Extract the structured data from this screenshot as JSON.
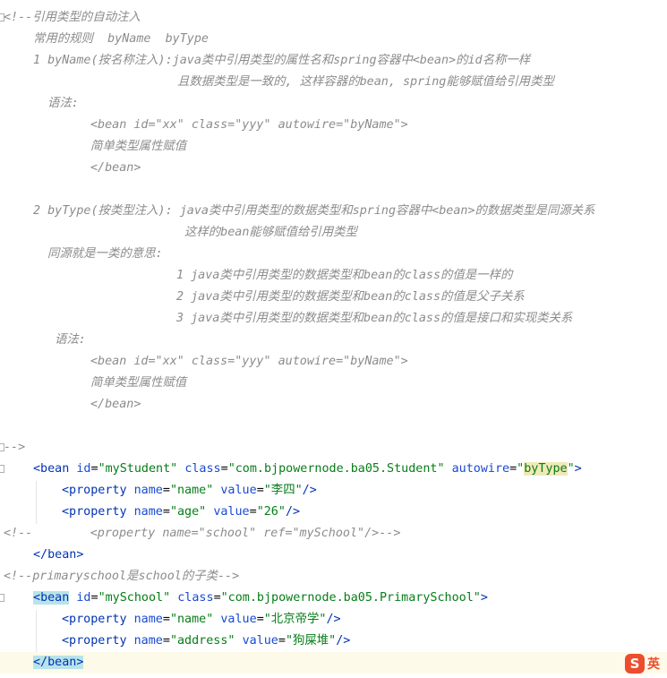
{
  "editor": {
    "lines": [
      "<!--引用类型的自动注入",
      "常用的规则  byName  byType",
      "1 byName(按名称注入):java类中引用类型的属性名和spring容器中<bean>的id名称一样",
      "且数据类型是一致的, 这样容器的bean, spring能够赋值给引用类型",
      "语法:",
      "<bean id=\"xx\" class=\"yyy\" autowire=\"byName\">",
      "简单类型属性赋值",
      "</bean>",
      "2 byType(按类型注入): java类中引用类型的数据类型和spring容器中<bean>的数据类型是同源关系",
      "这样的bean能够赋值给引用类型",
      "同源就是一类的意思:",
      "1 java类中引用类型的数据类型和bean的class的值是一样的",
      "2 java类中引用类型的数据类型和bean的class的值是父子关系",
      "3 java类中引用类型的数据类型和bean的class的值是接口和实现类关系",
      "语法:",
      "<bean id=\"xx\" class=\"yyy\" autowire=\"byName\">",
      "简单类型属性赋值",
      "</bean>",
      "-->"
    ],
    "code": {
      "bean1": {
        "open": "<bean",
        "id_attr": "id",
        "id_val": "\"myStudent\"",
        "class_attr": "class",
        "class_val": "\"com.bjpowernode.ba05.Student\"",
        "autowire_attr": "autowire",
        "q1": "\"",
        "autowire_val": "byType",
        "q2": "\"",
        "close": ">"
      },
      "prop_name": {
        "open": "<property",
        "attr1": "name",
        "val1": "\"name\"",
        "attr2": "value",
        "val2": "\"李四\"",
        "close": "/>"
      },
      "prop_age": {
        "open": "<property",
        "attr1": "name",
        "val1": "\"age\"",
        "attr2": "value",
        "val2": "\"26\"",
        "close": "/>"
      },
      "commented_prop": "<!--        <property name=\"school\" ref=\"mySchool\"/>-->",
      "bean1_end": "</bean>",
      "comment_primary": "<!--primaryschool是school的子类-->",
      "bean2": {
        "open_lt": "<",
        "open_word": "bean",
        "id_attr": "id",
        "id_val": "\"mySchool\"",
        "class_attr": "class",
        "class_val": "\"com.bjpowernode.ba05.PrimarySchool\"",
        "close": ">"
      },
      "prop_school_name": {
        "open": "<property",
        "attr1": "name",
        "val1": "\"name\"",
        "attr2": "value",
        "val2": "\"北京帝学\"",
        "close": "/>"
      },
      "prop_address": {
        "open": "<property",
        "attr1": "name",
        "val1": "\"address\"",
        "attr2": "value",
        "val2": "\"狗屎堆\"",
        "close": "/>"
      },
      "bean2_end_lt": "</",
      "bean2_end_word": "bean",
      "bean2_end_gt": ">"
    }
  },
  "ime": {
    "logo": "S",
    "lang": "英"
  },
  "colors": {
    "tag": "#0033b3",
    "attr_name": "#174ad4",
    "attr_value": "#067d17",
    "comment": "#8c8c8c"
  }
}
